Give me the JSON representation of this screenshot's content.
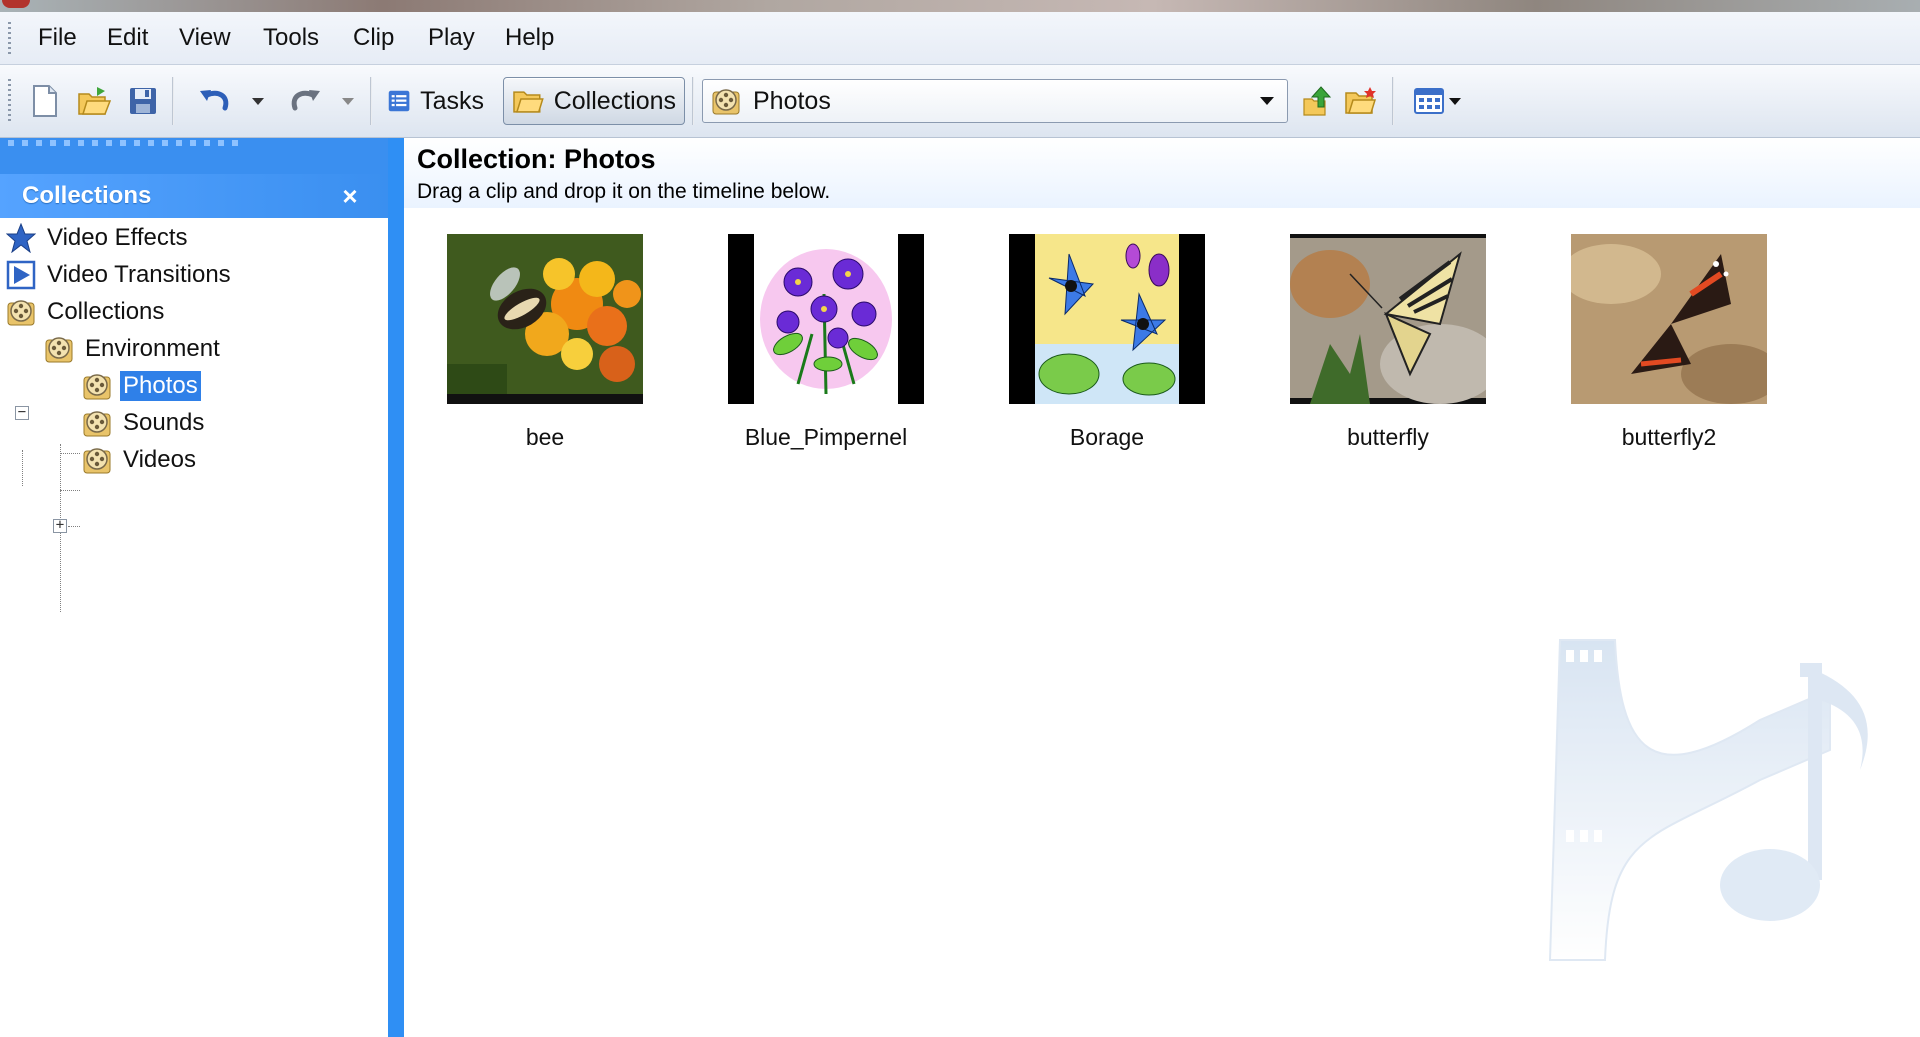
{
  "menu": [
    "File",
    "Edit",
    "View",
    "Tools",
    "Clip",
    "Play",
    "Help"
  ],
  "toolbar": {
    "tasks_label": "Tasks",
    "collections_label": "Collections",
    "location_value": "Photos"
  },
  "sidebar": {
    "title": "Collections",
    "close_glyph": "×",
    "tree": [
      {
        "label": "Video Effects",
        "icon": "star-icon"
      },
      {
        "label": "Video Transitions",
        "icon": "transition-icon"
      },
      {
        "label": "Collections",
        "icon": "film-reel-icon"
      },
      {
        "label": "Environment",
        "icon": "film-reel-icon"
      },
      {
        "label": "Photos",
        "icon": "film-reel-icon",
        "selected": true
      },
      {
        "label": "Sounds",
        "icon": "film-reel-icon"
      },
      {
        "label": "Videos",
        "icon": "film-reel-icon"
      }
    ]
  },
  "content": {
    "title": "Collection: Photos",
    "subtitle": "Drag a clip and drop it on the timeline below.",
    "clips": [
      {
        "name": "bee"
      },
      {
        "name": "Blue_Pimpernel"
      },
      {
        "name": "Borage"
      },
      {
        "name": "butterfly"
      },
      {
        "name": "butterfly2"
      }
    ]
  },
  "colors": {
    "accent": "#2f8ff4",
    "selection": "#2f80e8"
  }
}
